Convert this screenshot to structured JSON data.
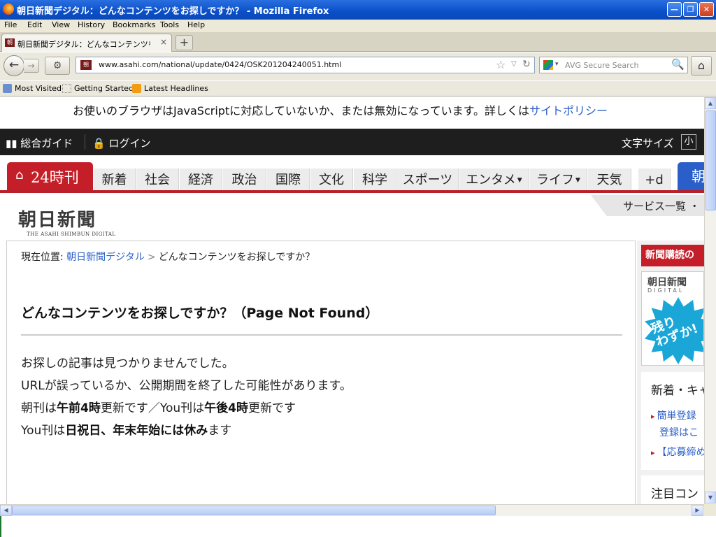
{
  "window": {
    "title": "朝日新聞デジタル：どんなコンテンツをお探しですか？ - Mozilla Firefox",
    "minimize_glyph": "—",
    "maximize_glyph": "❐",
    "close_glyph": "✕"
  },
  "menu": {
    "items": [
      {
        "label": "File"
      },
      {
        "label": "Edit"
      },
      {
        "label": "View"
      },
      {
        "label": "History"
      },
      {
        "label": "Bookmarks"
      },
      {
        "label": "Tools"
      },
      {
        "label": "Help"
      }
    ]
  },
  "tabs": {
    "active": {
      "favicon_text": "朝",
      "label": "朝日新聞デジタル：どんなコンテンツをお探し...",
      "close_glyph": "×"
    },
    "new_tab_glyph": "+"
  },
  "nav": {
    "back_glyph": "←",
    "forward_glyph": "→",
    "extra_glyph": "⚙",
    "url": "www.asahi.com/national/update/0424/OSK201204240051.html",
    "url_favicon_text": "朝",
    "bookmark_star_glyph": "☆",
    "dropdown_glyph": "▽",
    "reload_glyph": "↻",
    "search_placeholder": "AVG Secure Search",
    "search_dropdown_glyph": "▾",
    "search_go_glyph": "🔍",
    "home_glyph": "⌂"
  },
  "bookmarks": [
    {
      "label": "Most Visited",
      "icon": "most-visited-icon"
    },
    {
      "label": "Getting Started",
      "icon": "page-icon"
    },
    {
      "label": "Latest Headlines",
      "icon": "rss-icon"
    }
  ],
  "page": {
    "js_notice_text": "お使いのブラウザはJavaScriptに対応していないか、または無効になっています。詳しくは",
    "js_notice_link": "サイトポリシー",
    "topbar": {
      "guide": "総合ガイド",
      "login": "ログイン",
      "font_size_label": "文字サイズ",
      "font_size_small": "小"
    },
    "navtabs": {
      "home_glyph": "⌂",
      "tab24": "24時刊",
      "items": [
        {
          "label": "新着"
        },
        {
          "label": "社会"
        },
        {
          "label": "経済"
        },
        {
          "label": "政治"
        },
        {
          "label": "国際"
        },
        {
          "label": "文化"
        },
        {
          "label": "科学"
        },
        {
          "label": "スポーツ"
        },
        {
          "label": "エンタメ",
          "arrow": "▼"
        },
        {
          "label": "ライフ",
          "arrow": "▼"
        },
        {
          "label": "天気"
        },
        {
          "label": "+d"
        }
      ],
      "blue_tab": "朝"
    },
    "logo": {
      "main": "朝日新聞",
      "sub": "THE ASAHI SHIMBUN DIGITAL"
    },
    "service_list": "サービス一覧 ・",
    "breadcrumb": {
      "prefix": "現在位置:",
      "link": "朝日新聞デジタル",
      "separator": ">",
      "current": "どんなコンテンツをお探しですか？"
    },
    "heading": "どんなコンテンツをお探しですか？（Page Not Found）",
    "body": {
      "line1": "お探しの記事は見つかりませんでした。",
      "line2": "URLが誤っているか、公開期間を終了した可能性があります。",
      "line3_a": "朝刊は",
      "line3_b": "午前4時",
      "line3_c": "更新です／You刊は",
      "line3_d": "午後4時",
      "line3_e": "更新です",
      "line4_a": "You刊は",
      "line4_b": "日祝日、年末年始には休み",
      "line4_c": "ます"
    },
    "sidebar": {
      "red_header": "新聞購読の",
      "ad_title": "朝日新聞",
      "ad_sub": "DIGITAL",
      "ad_burst_line1": "残り",
      "ad_burst_line2": "わずか!",
      "section_heading": "新着・キャ",
      "link1": "簡単登録",
      "link1b": "登録はこ",
      "link2": "【応募締め",
      "section2_heading": "注目コン"
    }
  },
  "scroll": {
    "up_glyph": "▲",
    "down_glyph": "▼",
    "left_glyph": "◀",
    "right_glyph": "▶"
  }
}
